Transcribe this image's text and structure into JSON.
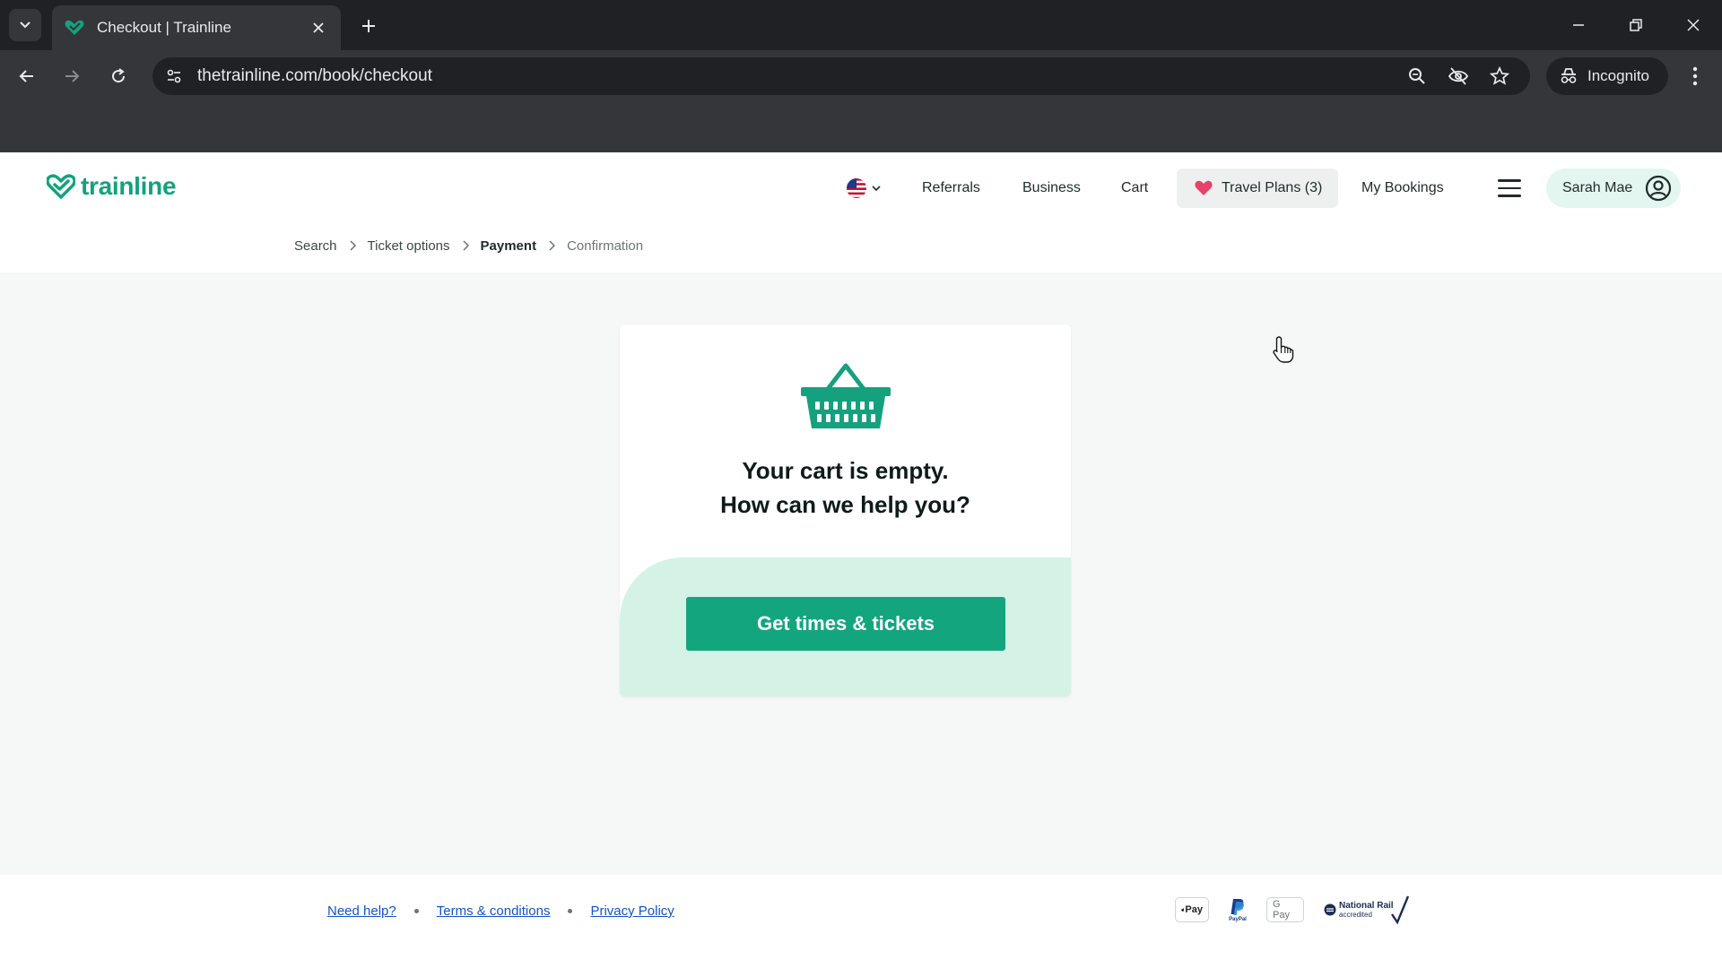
{
  "browser": {
    "tab": {
      "title": "Checkout | Trainline"
    },
    "url": "thetrainline.com/book/checkout",
    "incognito_label": "Incognito"
  },
  "site": {
    "brand": "trainline",
    "brand_color": "#15a17e",
    "nav": {
      "language_flag": "us-flag-icon",
      "referrals": "Referrals",
      "business": "Business",
      "cart": "Cart",
      "travel_plans": "Travel Plans (3)",
      "my_bookings": "My Bookings",
      "account": "Sarah Mae"
    },
    "breadcrumb": {
      "step1": "Search",
      "step2": "Ticket options",
      "step3": "Payment",
      "step4": "Confirmation"
    },
    "cart": {
      "line1": "Your cart is empty.",
      "line2": "How can we help you?",
      "cta": "Get times & tickets"
    },
    "footer": {
      "need_help": "Need help?",
      "terms": "Terms & conditions",
      "privacy": "Privacy Policy",
      "apple_pay": "Pay",
      "paypal": "PayPal",
      "google_pay": "G Pay",
      "national_rail": "National Rail",
      "national_rail_sub": "accredited"
    }
  }
}
